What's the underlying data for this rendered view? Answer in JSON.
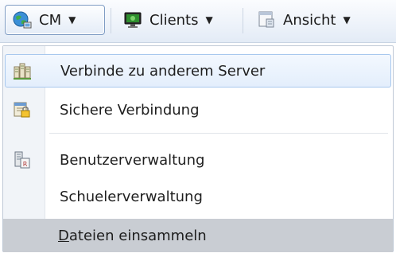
{
  "toolbar": {
    "cm_label": "CM",
    "clients_label": "Clients",
    "view_label": "Ansicht",
    "caret": "▼"
  },
  "menu": {
    "items": [
      {
        "label": "Verbinde zu anderem Server",
        "icon": "server-network-icon"
      },
      {
        "label": "Sichere Verbindung",
        "icon": "secure-connection-icon"
      },
      {
        "label": "Benutzerverwaltung",
        "icon": "user-admin-icon"
      },
      {
        "label": "Schuelerverwaltung",
        "icon": ""
      },
      {
        "label_underlined": "D",
        "label_rest": "ateien einsammeln",
        "icon": ""
      }
    ]
  },
  "colors": {
    "hover_border": "#a8c8ee",
    "bottom_bar": "#c9cdd3"
  }
}
